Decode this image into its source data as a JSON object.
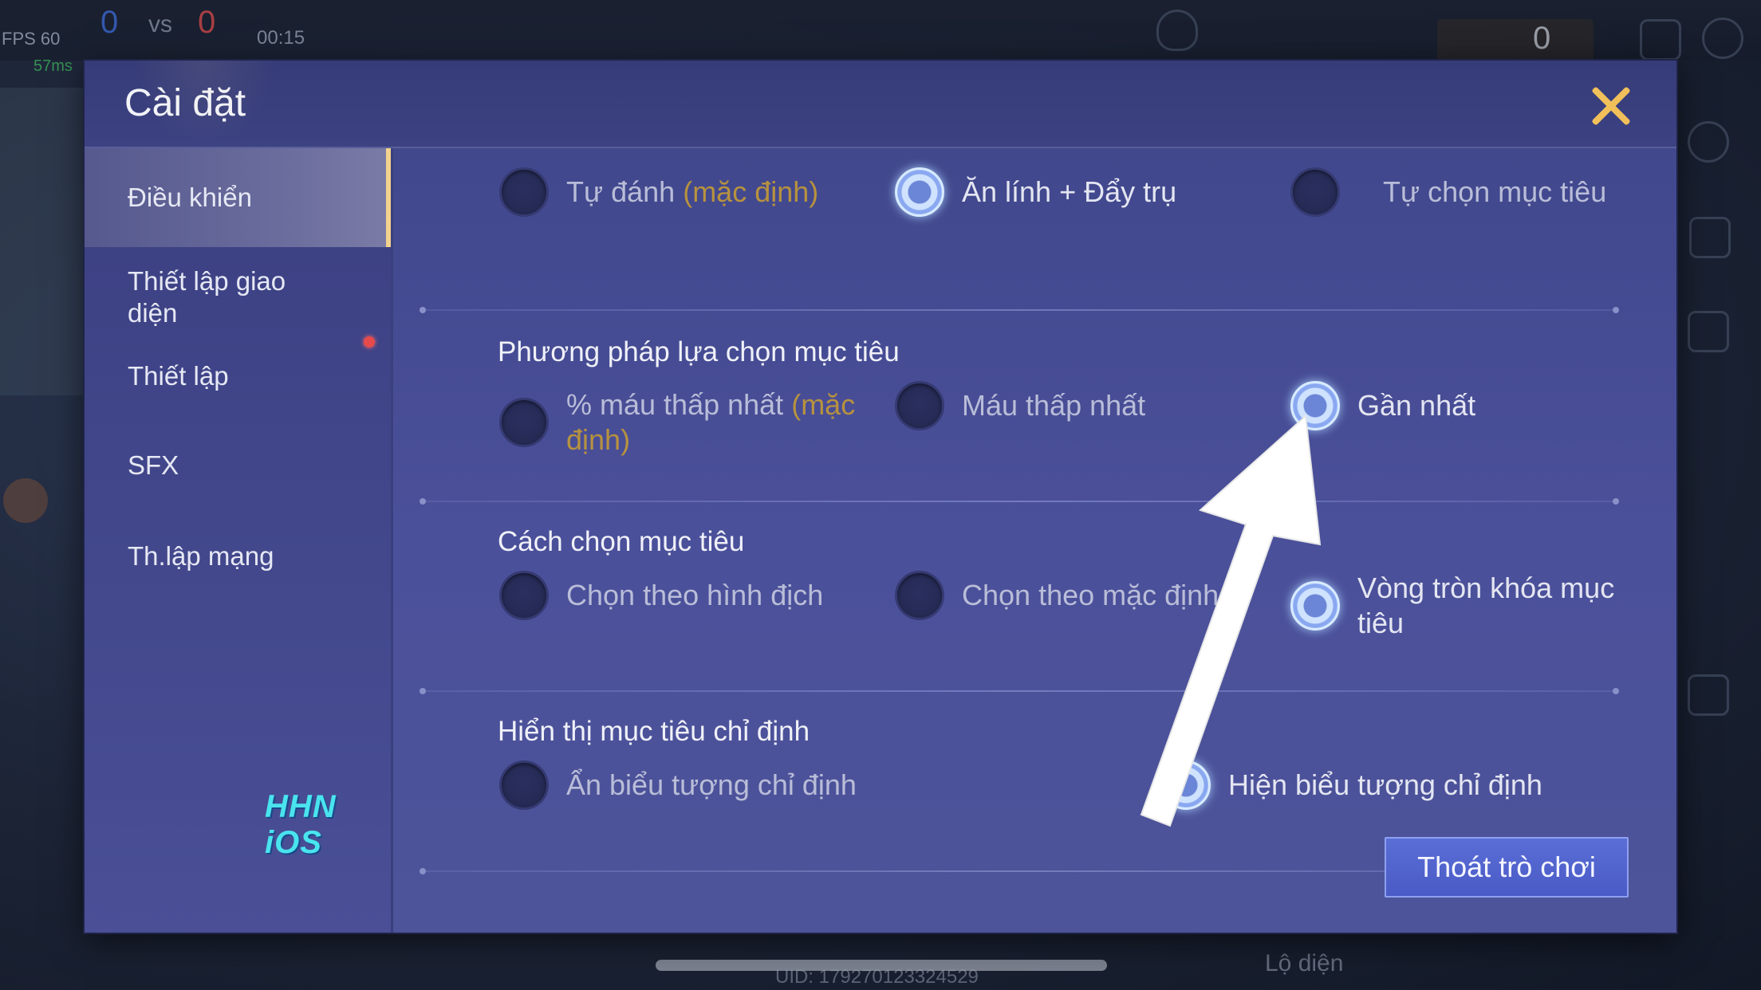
{
  "hud": {
    "fps": "FPS 60",
    "ping": "57ms",
    "score_left": "0",
    "vs": "vs",
    "score_right": "0",
    "timer": "00:15",
    "gold": "0",
    "uid": "UID: 179270123324529",
    "lo_dien": "Lộ diện"
  },
  "dialog": {
    "title": "Cài đặt",
    "exit_label": "Thoát trò chơi"
  },
  "sidebar": {
    "items": [
      {
        "label": "Điều khiển"
      },
      {
        "label": "Thiết lập giao diện"
      },
      {
        "label": "Thiết lập"
      },
      {
        "label": "SFX"
      },
      {
        "label": "Th.lập mạng"
      }
    ],
    "watermark": "HHN iOS"
  },
  "sections": {
    "attack": {
      "options": [
        {
          "label": "Tự đánh",
          "note": "(mặc định)",
          "selected": false
        },
        {
          "label": "Ăn lính + Đẩy trụ",
          "selected": true
        },
        {
          "label": "Tự chọn mục tiêu",
          "selected": false
        }
      ]
    },
    "target_method": {
      "title": "Phương pháp lựa chọn mục tiêu",
      "options": [
        {
          "label": "% máu thấp nhất",
          "note": "(mặc định)",
          "selected": false
        },
        {
          "label": "Máu thấp nhất",
          "selected": false
        },
        {
          "label": "Gần nhất",
          "selected": true
        }
      ]
    },
    "target_select": {
      "title": "Cách chọn mục tiêu",
      "options": [
        {
          "label": "Chọn theo hình địch",
          "selected": false
        },
        {
          "label": "Chọn theo mặc định",
          "selected": false
        },
        {
          "label": "Vòng tròn khóa mục tiêu",
          "selected": true
        }
      ]
    },
    "target_display": {
      "title": "Hiển thị mục tiêu chỉ định",
      "options": [
        {
          "label": "Ẩn biểu tượng chỉ định",
          "selected": false
        },
        {
          "label": "Hiện biểu tượng chỉ định",
          "selected": true
        }
      ]
    }
  }
}
